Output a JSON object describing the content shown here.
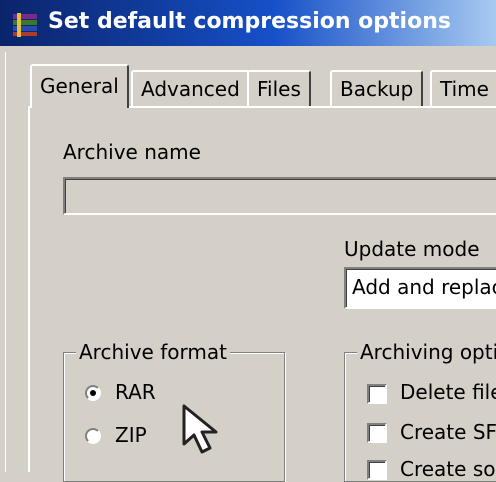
{
  "window": {
    "title": "Set default compression options",
    "icon": "winrar-books-icon"
  },
  "tabs": [
    {
      "label": "General",
      "active": true
    },
    {
      "label": "Advanced",
      "active": false
    },
    {
      "label": "Files",
      "active": false
    },
    {
      "label": "Backup",
      "active": false
    },
    {
      "label": "Time",
      "active": false
    }
  ],
  "general": {
    "archive_name_label": "Archive name",
    "archive_name_value": "",
    "update_mode_label": "Update mode",
    "update_mode_value": "Add and replac",
    "archive_format": {
      "title": "Archive format",
      "options": [
        {
          "label": "RAR",
          "selected": true
        },
        {
          "label": "ZIP",
          "selected": false
        }
      ]
    },
    "archiving_options": {
      "title": "Archiving optio",
      "items": [
        {
          "label": "Delete file",
          "checked": false
        },
        {
          "label": "Create SF",
          "checked": false
        },
        {
          "label": "Create so",
          "checked": false
        }
      ]
    }
  },
  "colors": {
    "face": "#d4d0c8",
    "title_start": "#0a246a",
    "title_end": "#a6caf0"
  }
}
